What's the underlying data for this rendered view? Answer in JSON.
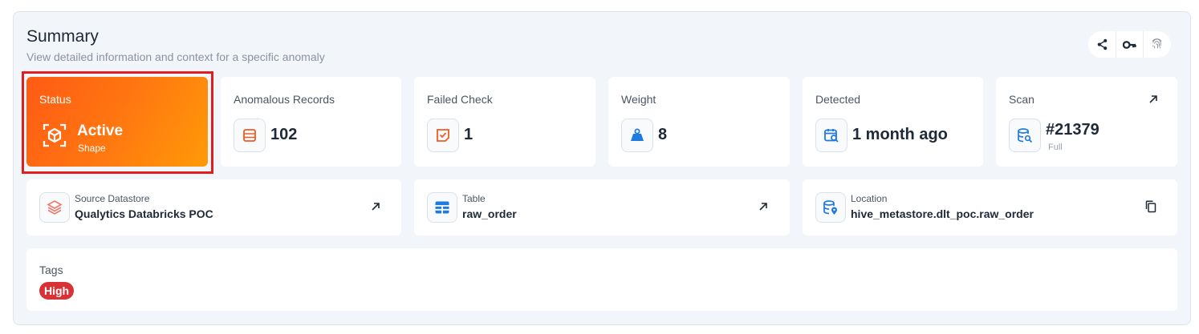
{
  "header": {
    "title": "Summary",
    "subtitle": "View detailed information and context for a specific anomaly"
  },
  "actions": [
    {
      "icon": "share-icon"
    },
    {
      "icon": "key-icon"
    },
    {
      "icon": "fingerprint-icon"
    }
  ],
  "status": {
    "label": "Status",
    "value": "Active",
    "sub": "Shape",
    "icon": "shape-cube-icon",
    "gradient_from": "#ff5a14",
    "gradient_to": "#ff9a08"
  },
  "anomalous_records": {
    "label": "Anomalous Records",
    "value": "102",
    "icon": "records-list-icon"
  },
  "failed_check": {
    "label": "Failed Check",
    "value": "1",
    "icon": "check-icon"
  },
  "weight": {
    "label": "Weight",
    "value": "8",
    "icon": "weight-icon"
  },
  "detected": {
    "label": "Detected",
    "value": "1 month ago",
    "icon": "calendar-search-icon"
  },
  "scan": {
    "label": "Scan",
    "value": "#21379",
    "sub": "Full",
    "icon": "database-search-icon"
  },
  "source_datastore": {
    "label": "Source Datastore",
    "value": "Qualytics Databricks POC",
    "icon": "databricks-icon"
  },
  "table": {
    "label": "Table",
    "value": "raw_order",
    "icon": "table-icon"
  },
  "location": {
    "label": "Location",
    "value": "hive_metastore.dlt_poc.raw_order",
    "icon": "location-database-icon"
  },
  "tags": {
    "label": "Tags",
    "items": [
      {
        "text": "High",
        "color": "#d93236"
      }
    ]
  },
  "colors": {
    "accent_orange": "#f05a22",
    "accent_blue": "#1f7ae0",
    "highlight_red": "#e11d1d"
  }
}
